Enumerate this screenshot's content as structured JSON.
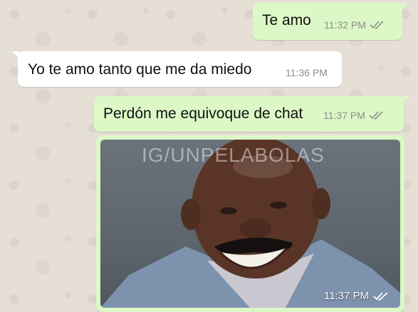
{
  "messages": [
    {
      "text": "Te amo",
      "time": "11:32 PM",
      "direction": "outgoing",
      "status": "read"
    },
    {
      "text": "Yo te amo tanto que me da miedo",
      "time": "11:36 PM",
      "direction": "incoming"
    },
    {
      "text": "Perdón me equivoque de chat",
      "time": "11:37 PM",
      "direction": "outgoing",
      "status": "read"
    }
  ],
  "image_message": {
    "watermark": "IG/UNPELABOLAS",
    "time": "11:37 PM",
    "status": "read",
    "photo_description_icon": "smiling-man-photo"
  },
  "colors": {
    "outgoing_bubble": "#dcf8c6",
    "incoming_bubble": "#ffffff",
    "chat_background": "#e6dfd6",
    "meta_text": "#8a8f8a"
  }
}
